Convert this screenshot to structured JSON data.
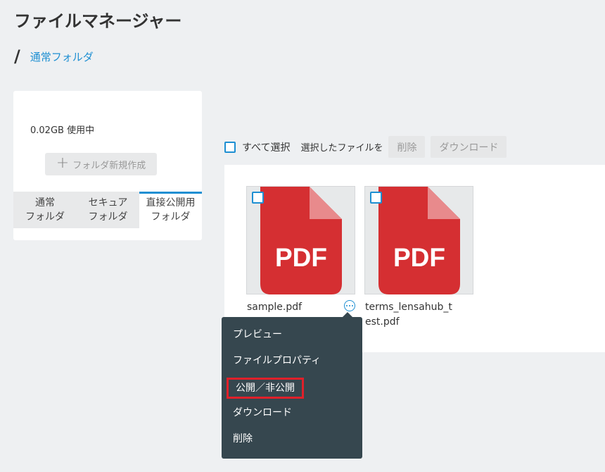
{
  "header": {
    "title": "ファイルマネージャー"
  },
  "breadcrumb": {
    "separator": "/",
    "current": "通常フォルダ"
  },
  "sidebar": {
    "storage": "0.02GB 使用中",
    "new_folder_label": "フォルダ新規作成",
    "tabs": [
      {
        "label": "通常\nフォルダ",
        "active": false
      },
      {
        "label": "セキュア\nフォルダ",
        "active": false
      },
      {
        "label": "直接公開用\nフォルダ",
        "active": true
      }
    ]
  },
  "toolbar": {
    "select_all": "すべて選択",
    "selected_files": "選択したファイルを",
    "delete_label": "削除",
    "download_label": "ダウンロード"
  },
  "files": [
    {
      "name": "sample.pdf",
      "icon_text": "PDF"
    },
    {
      "name": "terms_lensahub_test.pdf",
      "icon_text": "PDF"
    }
  ],
  "context_menu": {
    "items": [
      "プレビュー",
      "ファイルプロパティ",
      "公開／非公開",
      "ダウンロード",
      "削除"
    ]
  },
  "colors": {
    "accent": "#1e8fd2",
    "pdf_red": "#d52f32",
    "menu_bg": "#36474f",
    "highlight": "#e0202a"
  }
}
